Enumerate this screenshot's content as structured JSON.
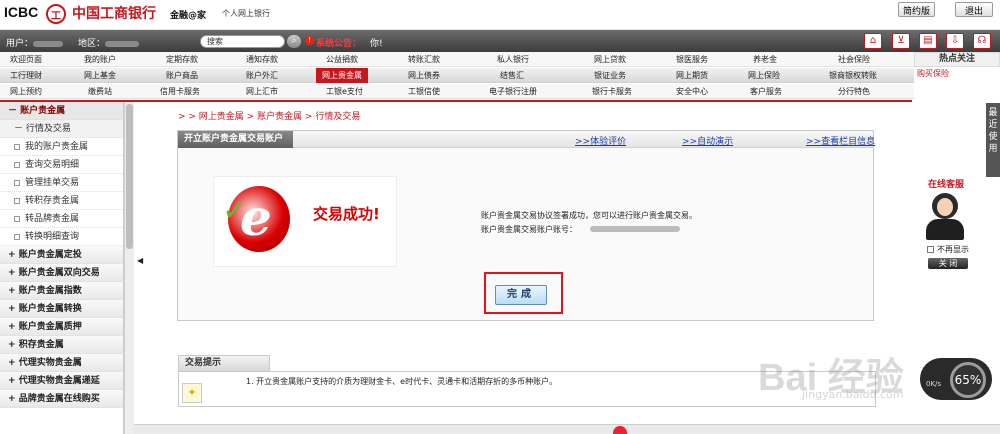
{
  "header": {
    "brand": "ICBC",
    "logo_char": "工",
    "bank_name": "中国工商银行",
    "slogan": "金融@家",
    "subtitle": "个人网上银行",
    "simple_label": "简约版",
    "exit_label": "退出"
  },
  "infobar": {
    "user_label": "用户：",
    "region_label": "地区：",
    "search_placeholder": "搜索",
    "notice_label": "系统公告：",
    "notice_text": "你!"
  },
  "nav": {
    "row1": [
      "欢迎页面",
      "我的账户",
      "定期存款",
      "通知存款",
      "公益捐款",
      "转账汇款",
      "私人银行",
      "网上贷款",
      "银医服务",
      "养老金",
      "社会保险"
    ],
    "row2": [
      "工行理财",
      "网上基金",
      "账户商品",
      "账户外汇",
      "网上贵金属",
      "网上债券",
      "结售汇",
      "银证业务",
      "网上期货",
      "网上保险",
      "银商银权转账"
    ],
    "row3": [
      "网上预约",
      "缴费站",
      "信用卡服务",
      "网上汇市",
      "工银e支付",
      "工银信使",
      "电子银行注册",
      "银行卡服务",
      "安全中心",
      "客户服务",
      "分行特色"
    ]
  },
  "hot": {
    "title": "热点关注",
    "item": "购买保险"
  },
  "sidebar": {
    "open_category": "账户贵金属",
    "items": [
      "行情及交易",
      "我的账户贵金属",
      "查询交易明细",
      "管理挂单交易",
      "转积存贵金属",
      "转品牌贵金属",
      "转换明细查询"
    ],
    "categories": [
      "账户贵金属定投",
      "账户贵金属双向交易",
      "账户贵金属指数",
      "账户贵金属转换",
      "账户贵金属质押",
      "积存贵金属",
      "代理实物贵金属",
      "代理实物贵金属递延",
      "品牌贵金属在线购买"
    ]
  },
  "breadcrumb": "> > 网上贵金属 > 账户贵金属 > 行情及交易",
  "panel": {
    "title": "开立账户贵金属交易账户",
    "links": [
      ">>体验评价",
      ">>自动演示",
      ">>查看栏目信息"
    ],
    "success_text": "交易成功!",
    "message_line1": "账户贵金属交易协议签署成功，您可以进行账户贵金属交易。",
    "message_line2": "账户贵金属交易账户账号：",
    "done_button": "完成"
  },
  "tips": {
    "title": "交易提示",
    "text": "1. 开立贵金属账户支持的介质为理财金卡、e时代卡、灵通卡和活期存折的多币种账户。"
  },
  "right": {
    "recent_tab": "最近使用",
    "online_title": "在线客服",
    "noshow_label": "不再显示",
    "close_label": "关 闭",
    "speed_rate": "0K/s",
    "speed_pct": "65%"
  },
  "watermark": {
    "main": "Bai 经验",
    "sub": "jingyan.baidu.com"
  },
  "colors": {
    "brand_red": "#c8161d",
    "link_blue": "#1a3fa8",
    "dark_bar": "#4a4a4a"
  },
  "icons": [
    "home-icon",
    "cart-icon",
    "card-icon",
    "download-icon",
    "headset-icon",
    "search-icon",
    "notice-icon",
    "lightbulb-icon",
    "check-icon"
  ]
}
